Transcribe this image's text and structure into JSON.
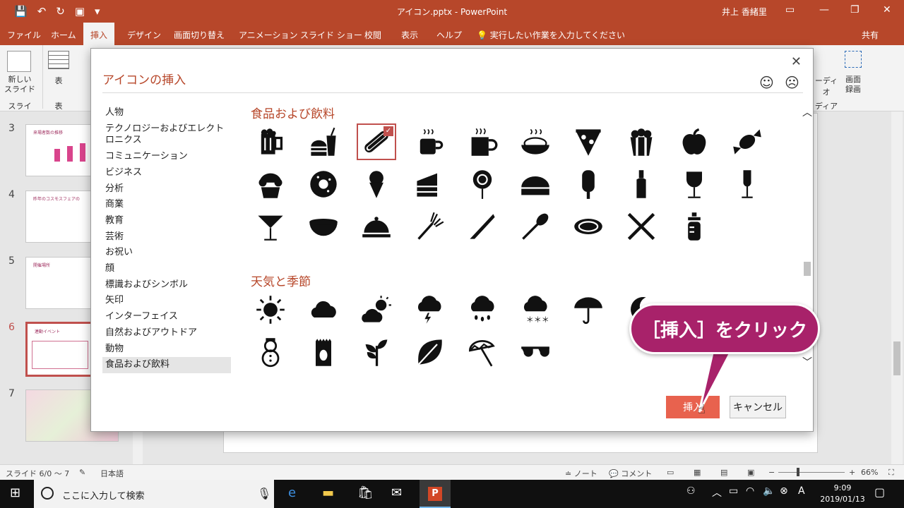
{
  "titlebar": {
    "title": "アイコン.pptx  -  PowerPoint",
    "user": "井上 香緒里",
    "save_icon": "💾",
    "undo_icon": "↶",
    "redo_icon": "↻",
    "present_icon": "▣",
    "more_icon": "▾",
    "min": "—",
    "restore": "❐",
    "close": "✕",
    "display_options": "▭"
  },
  "tabs": [
    "ファイル",
    "ホーム",
    "挿入",
    "デザイン",
    "画面切り替え",
    "アニメーション",
    "スライド ショー",
    "校閲",
    "表示",
    "ヘルプ",
    "💡 実行したい作業を入力してください"
  ],
  "share": "共有",
  "ribbon": {
    "new_slide": "新しい\nスライド",
    "new_slide_group": "スライド",
    "table": "表",
    "table_group": "表",
    "screen_rec": "画面\n録画",
    "video_partial": "ーディオ",
    "media_group": "ディア"
  },
  "slides": [
    {
      "num": "3",
      "title": "来場者数の推移"
    },
    {
      "num": "4",
      "title": "昨年のコスモスフェアの"
    },
    {
      "num": "5",
      "title": "開催場所"
    },
    {
      "num": "6",
      "title": "連動イベント"
    },
    {
      "num": "7",
      "title": ""
    }
  ],
  "dialog": {
    "title": "アイコンの挿入",
    "close": "✕",
    "smile": "☺",
    "frown": "☹",
    "categories": [
      "人物",
      "テクノロジーおよびエレクトロニクス",
      "コミュニケーション",
      "ビジネス",
      "分析",
      "商業",
      "教育",
      "芸術",
      "お祝い",
      "顔",
      "標識およびシンボル",
      "矢印",
      "インターフェイス",
      "自然およびアウトドア",
      "動物",
      "食品および飲料"
    ],
    "selected_category": "食品および飲料",
    "section1": "食品および飲料",
    "section2": "天気と季節",
    "insert": "挿入",
    "cancel": "キャンセル",
    "scroll_up": "︿",
    "scroll_down": "﹀",
    "selected_check": "✓"
  },
  "callout": "［挿入］をクリック",
  "status": {
    "slide": "スライド 6/0 〜 7",
    "lang": "日本語",
    "notes": "≐ ノート",
    "comments": "💬 コメント",
    "zoom": "66%",
    "minus": "−",
    "plus": "+"
  },
  "taskbar": {
    "search": "ここに入力して検索",
    "time": "9:09",
    "date": "2019/01/13"
  }
}
